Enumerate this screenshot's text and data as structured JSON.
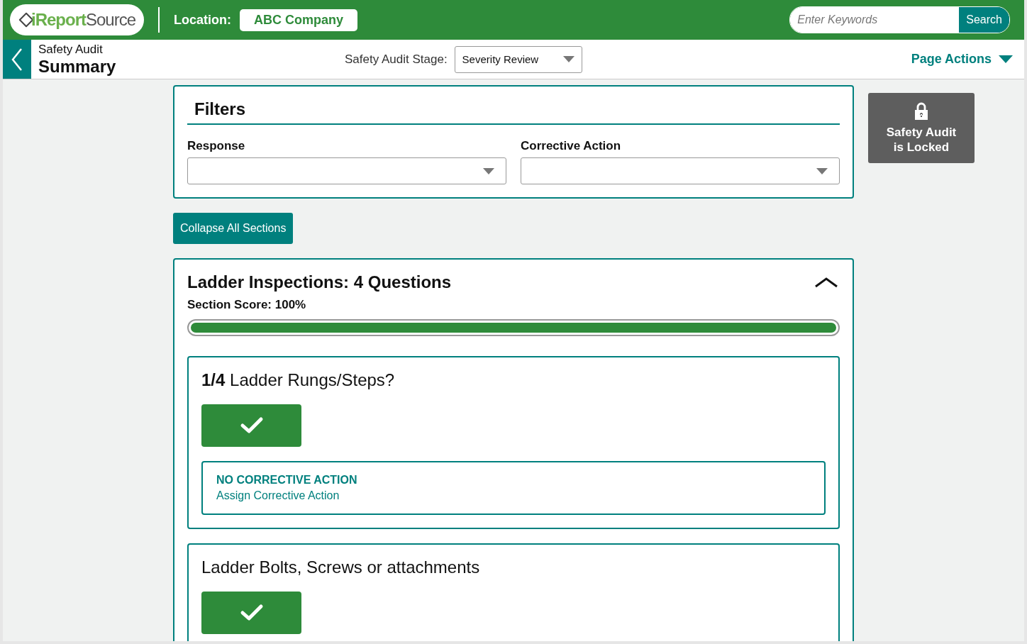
{
  "header": {
    "logo": {
      "primary": "iReport",
      "secondary": "Source"
    },
    "location_label": "Location:",
    "location": "ABC Company",
    "search": {
      "placeholder": "Enter Keywords",
      "button": "Search"
    }
  },
  "subheader": {
    "overline": "Safety Audit",
    "title": "Summary",
    "stage_label": "Safety Audit Stage:",
    "stage": "Severity Review",
    "page_actions": "Page Actions"
  },
  "filters": {
    "title": "Filters",
    "fields": [
      {
        "label": "Response"
      },
      {
        "label": "Corrective Action"
      }
    ]
  },
  "collapse_button": "Collapse All Sections",
  "lock_card": {
    "line_1": "Safety Audit",
    "line_2": "is Locked"
  },
  "section": {
    "title": "Ladder Inspections: 4 Questions",
    "expanded": true,
    "score": "Section Score: 100%",
    "level": 1.0,
    "questions": [
      {
        "text": "**1/4** Ladder Rungs/Steps?",
        "passed": true,
        "corrective": {
          "status": "NO CORRECTIVE ACTION",
          "link": "Assign Corrective Action"
        }
      },
      {
        "text": "Ladder Bolts, Screws or attachments",
        "passed": true
      }
    ]
  }
}
